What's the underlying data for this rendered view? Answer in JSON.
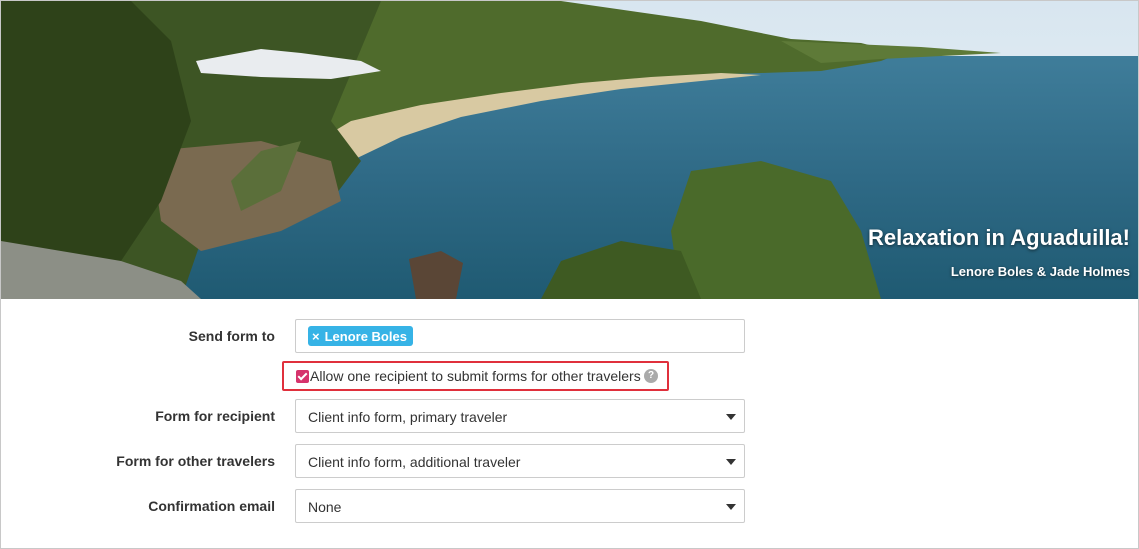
{
  "hero": {
    "title": "Relaxation in Aguaduilla!",
    "travelers": "Lenore Boles & Jade Holmes"
  },
  "form": {
    "send_to_label": "Send form to",
    "recipients": [
      {
        "name": "Lenore Boles",
        "remove_symbol": "×"
      }
    ],
    "allow_label": "Allow one recipient to submit forms for other travelers",
    "allow_checked": true,
    "help_symbol": "?",
    "recipient_form_label": "Form for recipient",
    "recipient_form_value": "Client info form, primary traveler",
    "other_form_label": "Form for other travelers",
    "other_form_value": "Client info form, additional traveler",
    "confirmation_label": "Confirmation email",
    "confirmation_value": "None"
  },
  "colors": {
    "tag": "#36b3e6",
    "checkbox": "#d6336c",
    "highlight_border": "#e0303c"
  }
}
